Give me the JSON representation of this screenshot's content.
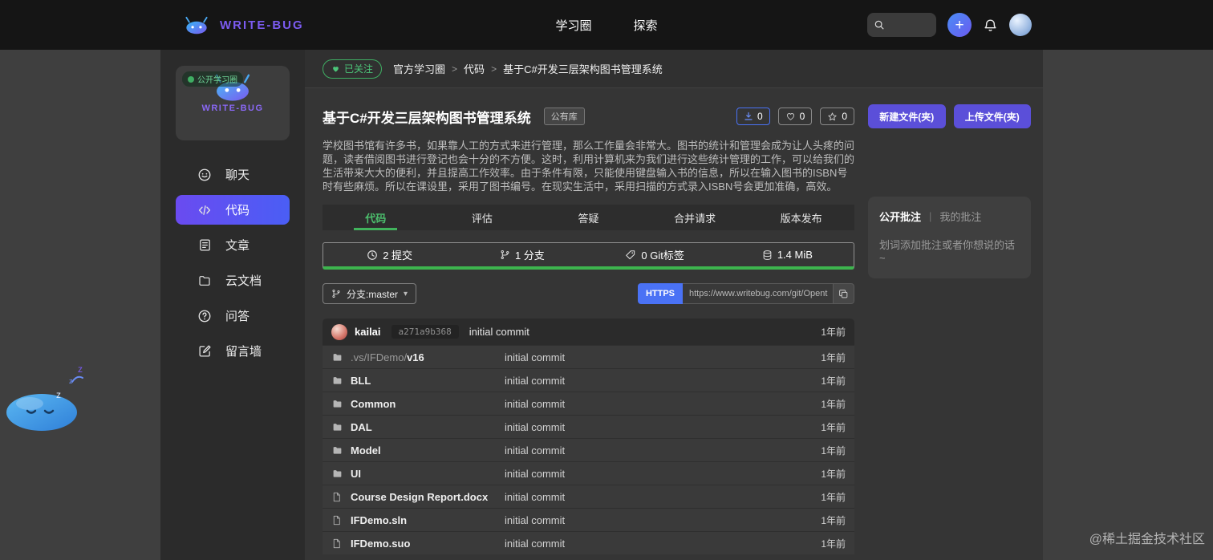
{
  "colors": {
    "accent_green": "#3db54e",
    "accent_purple": "#5b4fd9",
    "accent_blue": "#4a72f5",
    "brand_purple": "#7b5bf0",
    "navbar_bg": "#151515",
    "sidebar_bg": "#2b2b2b",
    "content_bg": "#353535"
  },
  "icons": {
    "caret": "▾",
    "plus": "+"
  },
  "navbar": {
    "brand": "WRITE-BUG",
    "links": [
      "学习圈",
      "探索"
    ],
    "search": {
      "value": "",
      "placeholder": ""
    }
  },
  "sidebar": {
    "card": {
      "badge": "公开学习圈",
      "name": "WRITE-BUG"
    },
    "items": [
      {
        "label": "聊天",
        "icon": "chat-icon"
      },
      {
        "label": "代码",
        "icon": "code-icon",
        "active": true
      },
      {
        "label": "文章",
        "icon": "article-icon"
      },
      {
        "label": "云文档",
        "icon": "cloud-doc-icon"
      },
      {
        "label": "问答",
        "icon": "qa-icon"
      },
      {
        "label": "留言墙",
        "icon": "message-wall-icon"
      }
    ]
  },
  "breadcrumb": {
    "follow_button": "已关注",
    "separator": ">",
    "items": [
      "官方学习圈",
      "代码",
      "基于C#开发三层架构图书管理系统"
    ]
  },
  "repo": {
    "title": "基于C#开发三层架构图书管理系统",
    "visibility_tag": "公有库",
    "counters": {
      "downloads": "0",
      "likes": "0",
      "stars": "0"
    },
    "actions": {
      "new_file": "新建文件(夹)",
      "upload_file": "上传文件(夹)"
    },
    "description": "学校图书馆有许多书，如果靠人工的方式来进行管理，那么工作量会非常大。图书的统计和管理会成为让人头疼的问题，读者借阅图书进行登记也会十分的不方便。这时，利用计算机来为我们进行这些统计管理的工作，可以给我们的生活带来大大的便利，并且提高工作效率。由于条件有限，只能使用键盘输入书的信息，所以在输入图书的ISBN号时有些麻烦。所以在课设里，采用了图书编号。在现实生活中，采用扫描的方式录入ISBN号会更加准确，高效。",
    "tabs": [
      "代码",
      "评估",
      "答疑",
      "合并请求",
      "版本发布"
    ],
    "active_tab": "代码",
    "stats": [
      {
        "icon": "clock-icon",
        "label": "2 提交"
      },
      {
        "icon": "branch-icon",
        "label": "1 分支"
      },
      {
        "icon": "tag-icon",
        "label": "0 Git标签"
      },
      {
        "icon": "database-icon",
        "label": "1.4 MiB"
      }
    ],
    "branch_selector": "分支:master",
    "clone": {
      "protocol": "HTTPS",
      "url": "https://www.writebug.com/git/Opent"
    },
    "commit": {
      "author": "kailai",
      "hash": "a271a9b368",
      "message": "initial commit",
      "time": "1年前"
    },
    "files": [
      {
        "prefix": ".vs/IFDemo/",
        "name": "v16",
        "icon": "folder-icon",
        "message": "initial commit",
        "time": "1年前"
      },
      {
        "prefix": "",
        "name": "BLL",
        "icon": "folder-icon",
        "message": "initial commit",
        "time": "1年前"
      },
      {
        "prefix": "",
        "name": "Common",
        "icon": "folder-icon",
        "message": "initial commit",
        "time": "1年前"
      },
      {
        "prefix": "",
        "name": "DAL",
        "icon": "folder-icon",
        "message": "initial commit",
        "time": "1年前"
      },
      {
        "prefix": "",
        "name": "Model",
        "icon": "folder-icon",
        "message": "initial commit",
        "time": "1年前"
      },
      {
        "prefix": "",
        "name": "UI",
        "icon": "folder-icon",
        "message": "initial commit",
        "time": "1年前"
      },
      {
        "prefix": "",
        "name": "Course Design Report.docx",
        "icon": "file-icon",
        "message": "initial commit",
        "time": "1年前"
      },
      {
        "prefix": "",
        "name": "IFDemo.sln",
        "icon": "file-icon",
        "message": "initial commit",
        "time": "1年前"
      },
      {
        "prefix": "",
        "name": "IFDemo.suo",
        "icon": "file-icon",
        "message": "initial commit",
        "time": "1年前"
      }
    ]
  },
  "annotation_panel": {
    "tab_public": "公开批注",
    "separator": "|",
    "tab_mine": "我的批注",
    "hint": "划词添加批注或者你想说的话~"
  },
  "watermark": "@稀土掘金技术社区"
}
